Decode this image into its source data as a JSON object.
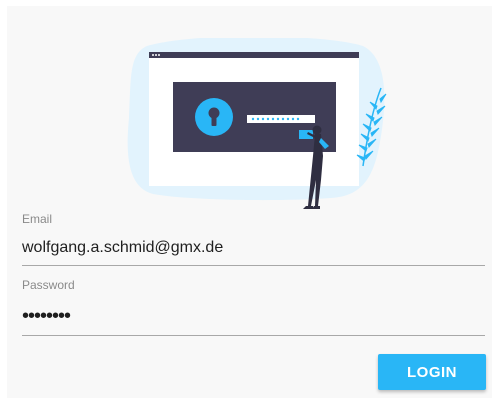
{
  "colors": {
    "accent": "#29b6f6",
    "illustration_dark": "#3f3d56",
    "card_background": "#f8f8f8"
  },
  "icons": {
    "illustration": "unlock-screen-illustration",
    "keyhole": "keyhole-icon"
  },
  "form": {
    "email": {
      "label": "Email",
      "value": "wolfgang.a.schmid@gmx.de"
    },
    "password": {
      "label": "Password",
      "value": "••••••••"
    },
    "login_label": "LOGIN"
  }
}
